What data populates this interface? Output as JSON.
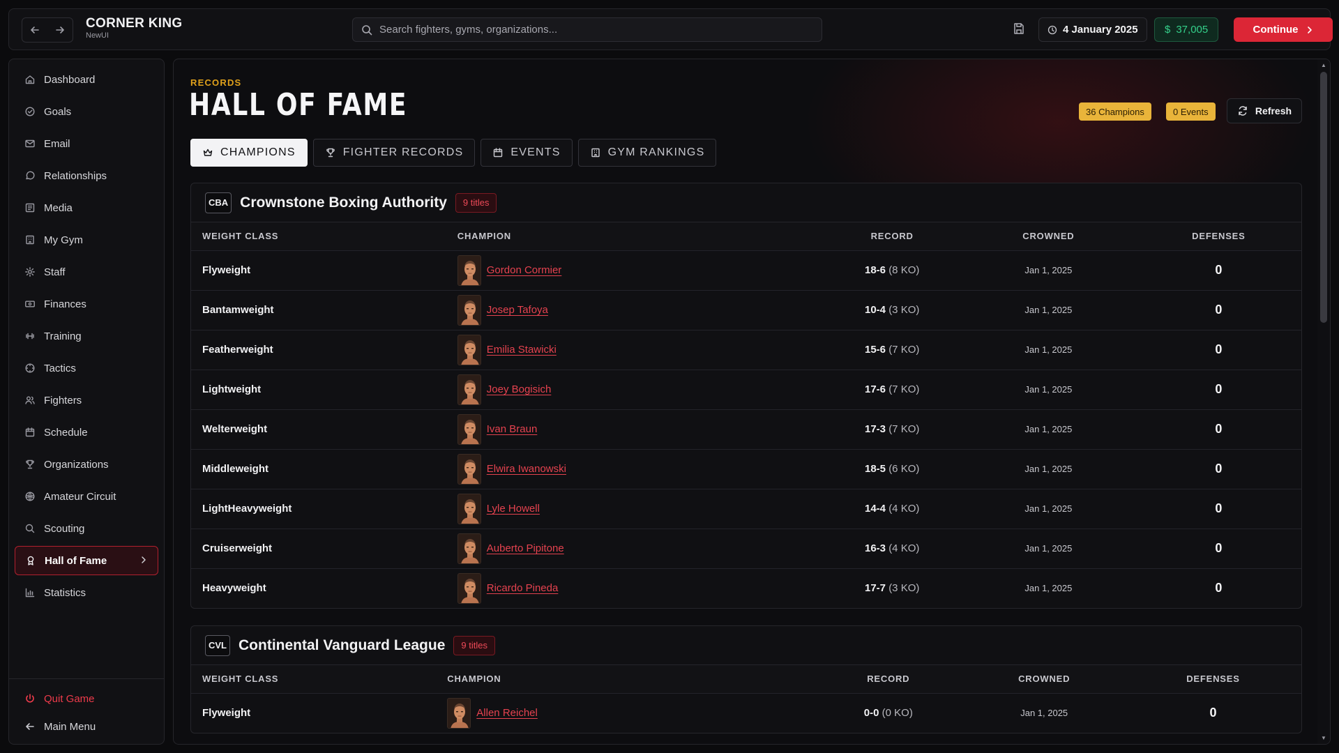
{
  "app": {
    "title": "CORNER KING",
    "subtitle": "NewUI"
  },
  "search": {
    "placeholder": "Search fighters, gyms, organizations..."
  },
  "topbar": {
    "date": "4 January 2025",
    "money": "$37,005",
    "money_symbol": "$",
    "money_value": "$37,005",
    "continue_label": "Continue"
  },
  "sidebar": {
    "items": [
      {
        "label": "Dashboard",
        "icon": "home-icon"
      },
      {
        "label": "Goals",
        "icon": "target-icon"
      },
      {
        "label": "Email",
        "icon": "mail-icon"
      },
      {
        "label": "Relationships",
        "icon": "chat-icon"
      },
      {
        "label": "Media",
        "icon": "newspaper-icon"
      },
      {
        "label": "My Gym",
        "icon": "building-icon"
      },
      {
        "label": "Staff",
        "icon": "gear-icon"
      },
      {
        "label": "Finances",
        "icon": "banknote-icon"
      },
      {
        "label": "Training",
        "icon": "dumbbell-icon"
      },
      {
        "label": "Tactics",
        "icon": "crosshair-icon"
      },
      {
        "label": "Fighters",
        "icon": "users-icon"
      },
      {
        "label": "Schedule",
        "icon": "calendar-icon"
      },
      {
        "label": "Organizations",
        "icon": "trophy-icon"
      },
      {
        "label": "Amateur Circuit",
        "icon": "globe-icon"
      },
      {
        "label": "Scouting",
        "icon": "search-icon"
      },
      {
        "label": "Hall of Fame",
        "icon": "award-icon",
        "active": true
      },
      {
        "label": "Statistics",
        "icon": "bar-chart-icon"
      }
    ],
    "quit_label": "Quit Game",
    "menu_label": "Main Menu"
  },
  "page": {
    "eyebrow": "RECORDS",
    "title": "HALL OF FAME",
    "champions_badge": "36 Champions",
    "events_badge": "0 Events",
    "refresh_label": "Refresh",
    "tabs": [
      {
        "label": "CHAMPIONS",
        "icon": "crown-icon",
        "active": true
      },
      {
        "label": "FIGHTER RECORDS",
        "icon": "trophy-icon"
      },
      {
        "label": "EVENTS",
        "icon": "calendar-icon"
      },
      {
        "label": "GYM RANKINGS",
        "icon": "building-icon"
      }
    ]
  },
  "columns": {
    "weight_class": "WEIGHT CLASS",
    "champion": "CHAMPION",
    "record": "RECORD",
    "crowned": "CROWNED",
    "defenses": "DEFENSES"
  },
  "orgs": [
    {
      "abbr": "CBA",
      "name": "Crownstone Boxing Authority",
      "titles": "9 titles",
      "rows": [
        {
          "weight": "Flyweight",
          "champion": "Gordon Cormier",
          "record": "18-6",
          "ko": "(8 KO)",
          "crowned": "Jan 1, 2025",
          "defenses": "0"
        },
        {
          "weight": "Bantamweight",
          "champion": "Josep Tafoya",
          "record": "10-4",
          "ko": "(3 KO)",
          "crowned": "Jan 1, 2025",
          "defenses": "0"
        },
        {
          "weight": "Featherweight",
          "champion": "Emilia Stawicki",
          "record": "15-6",
          "ko": "(7 KO)",
          "crowned": "Jan 1, 2025",
          "defenses": "0"
        },
        {
          "weight": "Lightweight",
          "champion": "Joey Bogisich",
          "record": "17-6",
          "ko": "(7 KO)",
          "crowned": "Jan 1, 2025",
          "defenses": "0"
        },
        {
          "weight": "Welterweight",
          "champion": "Ivan Braun",
          "record": "17-3",
          "ko": "(7 KO)",
          "crowned": "Jan 1, 2025",
          "defenses": "0"
        },
        {
          "weight": "Middleweight",
          "champion": "Elwira Iwanowski",
          "record": "18-5",
          "ko": "(6 KO)",
          "crowned": "Jan 1, 2025",
          "defenses": "0"
        },
        {
          "weight": "LightHeavyweight",
          "champion": "Lyle Howell",
          "record": "14-4",
          "ko": "(4 KO)",
          "crowned": "Jan 1, 2025",
          "defenses": "0"
        },
        {
          "weight": "Cruiserweight",
          "champion": "Auberto Pipitone",
          "record": "16-3",
          "ko": "(4 KO)",
          "crowned": "Jan 1, 2025",
          "defenses": "0"
        },
        {
          "weight": "Heavyweight",
          "champion": "Ricardo Pineda",
          "record": "17-7",
          "ko": "(3 KO)",
          "crowned": "Jan 1, 2025",
          "defenses": "0"
        }
      ]
    },
    {
      "abbr": "CVL",
      "name": "Continental Vanguard League",
      "titles": "9 titles",
      "rows": [
        {
          "weight": "Flyweight",
          "champion": "Allen Reichel",
          "record": "0-0",
          "ko": "(0 KO)",
          "crowned": "Jan 1, 2025",
          "defenses": "0"
        }
      ]
    }
  ],
  "colors": {
    "accent": "#dc2636",
    "amber": "#e9b43a",
    "money": "#34d08a",
    "link": "#e5424f"
  }
}
